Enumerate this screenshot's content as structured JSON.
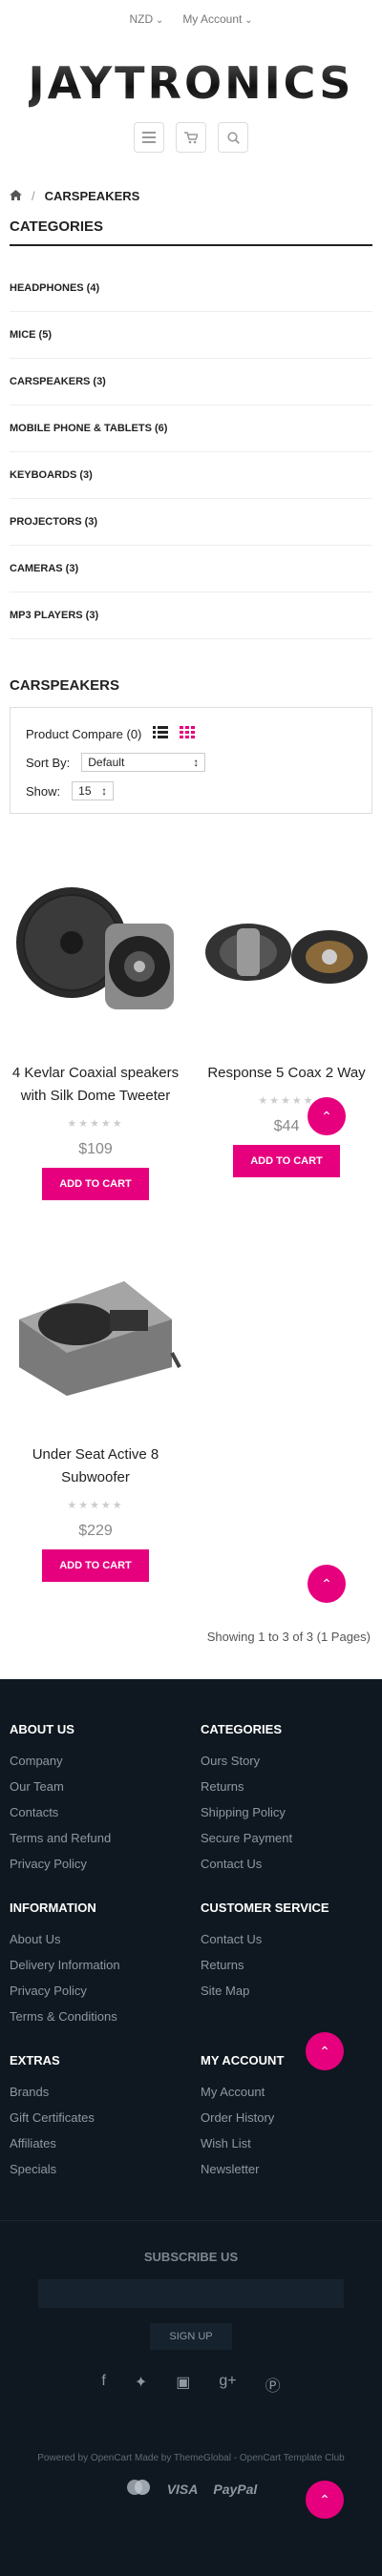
{
  "topbar": {
    "currency": "NZD",
    "account": "My Account"
  },
  "brand": {
    "logo_text": "JAYTRONICS",
    "accent": "#e6007e"
  },
  "header_icons": {
    "menu": "menu-icon",
    "cart": "cart-icon",
    "search": "search-icon"
  },
  "breadcrumb": {
    "home": "home-icon",
    "current": "CARSPEAKERS"
  },
  "categories": {
    "title": "CATEGORIES",
    "items": [
      "HEADPHONES (4)",
      "MICE (5)",
      "CARSPEAKERS (3)",
      "MOBILE PHONE & TABLETS (6)",
      "KEYBOARDS (3)",
      "PROJECTORS (3)",
      "CAMERAS (3)",
      "MP3 PLAYERS (3)"
    ]
  },
  "listing": {
    "title": "CARSPEAKERS",
    "compare": "Product Compare (0)",
    "sort_label": "Sort By:",
    "sort_value": "Default",
    "show_label": "Show:",
    "show_value": "15"
  },
  "products": [
    {
      "name": "4 Kevlar Coaxial speakers with Silk Dome Tweeter",
      "price": "$109",
      "cta": "ADD TO CART"
    },
    {
      "name": "Response 5 Coax 2 Way",
      "price": "$44",
      "cta": "ADD TO CART"
    },
    {
      "name": "Under Seat Active 8 Subwoofer",
      "price": "$229",
      "cta": "ADD TO CART"
    }
  ],
  "pagination": {
    "summary": "Showing 1 to 3 of 3 (1 Pages)"
  },
  "footer": {
    "about": {
      "title": "ABOUT US",
      "links": [
        "Company",
        "Our Team",
        "Contacts",
        "Terms and Refund",
        "Privacy Policy"
      ]
    },
    "categories": {
      "title": "CATEGORIES",
      "links": [
        "Ours Story",
        "Returns",
        "Shipping Policy",
        "Secure Payment",
        "Contact Us"
      ]
    },
    "information": {
      "title": "INFORMATION",
      "links": [
        "About Us",
        "Delivery Information",
        "Privacy Policy",
        "Terms & Conditions"
      ]
    },
    "service": {
      "title": "CUSTOMER SERVICE",
      "links": [
        "Contact Us",
        "Returns",
        "Site Map"
      ]
    },
    "extras": {
      "title": "EXTRAS",
      "links": [
        "Brands",
        "Gift Certificates",
        "Affiliates",
        "Specials"
      ]
    },
    "account": {
      "title": "MY ACCOUNT",
      "links": [
        "My Account",
        "Order History",
        "Wish List",
        "Newsletter"
      ]
    },
    "subscribe": {
      "title": "SUBSCRIBE US",
      "button": "SIGN UP"
    },
    "powered": "Powered by OpenCart Made by ThemeGlobal - OpenCart Template Club",
    "payments": {
      "visa": "VISA",
      "paypal": "PayPal"
    }
  }
}
